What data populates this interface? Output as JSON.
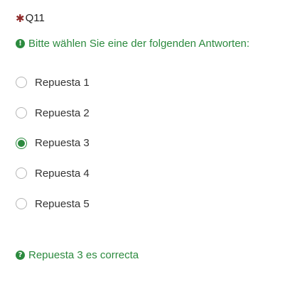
{
  "question": {
    "mandatory_marker": "✱",
    "code": "Q11",
    "instruction": "Bitte wählen Sie eine der folgenden Antworten:",
    "instruction_icon": "exclamation-circle-icon",
    "answers": [
      {
        "label": "Repuesta 1",
        "checked": false
      },
      {
        "label": "Repuesta 2",
        "checked": false
      },
      {
        "label": "Repuesta 3",
        "checked": true
      },
      {
        "label": "Repuesta 4",
        "checked": false
      },
      {
        "label": "Repuesta 5",
        "checked": false
      }
    ],
    "feedback": "Repuesta 3 es correcta",
    "feedback_icon": "question-circle-icon"
  },
  "colors": {
    "accent_green": "#2b8a3e",
    "mandatory_red": "#8f2a2a"
  }
}
